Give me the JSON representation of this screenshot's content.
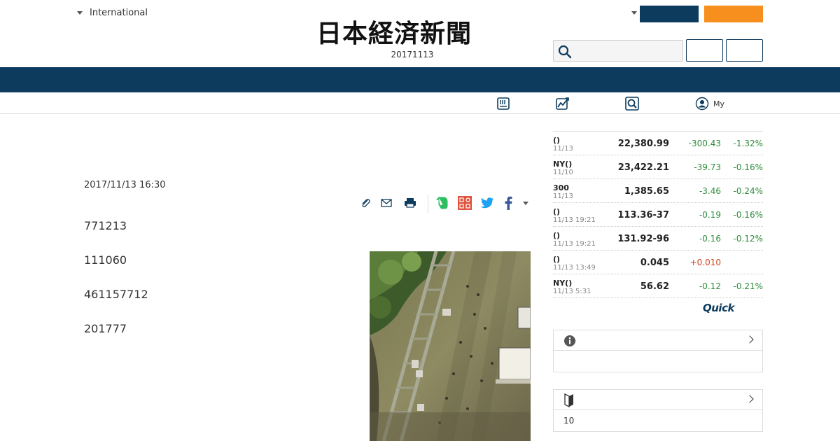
{
  "header": {
    "edition_label": "International",
    "logo_text": "日本経済新聞",
    "date": "20171113"
  },
  "subnav": {
    "my_label": "My"
  },
  "article": {
    "timestamp": "2017/11/13 16:30",
    "paragraphs": [
      "771213",
      "111060",
      "461157712",
      "201777"
    ]
  },
  "market": {
    "rows": [
      {
        "name": "()",
        "time": "11/13",
        "value": "22,380.99",
        "change": "-300.43",
        "pct": "-1.32%"
      },
      {
        "name": "NY()",
        "time": "11/10",
        "value": "23,422.21",
        "change": "-39.73",
        "pct": "-0.16%"
      },
      {
        "name": "300",
        "time": "11/13",
        "value": "1,385.65",
        "change": "-3.46",
        "pct": "-0.24%"
      },
      {
        "name": "()",
        "time": "11/13 19:21",
        "value": "113.36-37",
        "change": "-0.19",
        "pct": "-0.16%"
      },
      {
        "name": "()",
        "time": "11/13 19:21",
        "value": "131.92-96",
        "change": "-0.16",
        "pct": "-0.12%"
      },
      {
        "name": "()",
        "time": "11/13 13:49",
        "value": "0.045",
        "change": "+0.010",
        "pct": ""
      },
      {
        "name": "NY()",
        "time": "11/13 5:31",
        "value": "56.62",
        "change": "-0.12",
        "pct": "-0.21%"
      }
    ],
    "provider_logo": "Quick"
  },
  "boxes": {
    "info_body": "",
    "beginner_body": "10"
  },
  "colors": {
    "navy": "#0d3b5e",
    "orange": "#f78f1e",
    "negative": "#2e8b3a",
    "positive": "#d0421b"
  }
}
